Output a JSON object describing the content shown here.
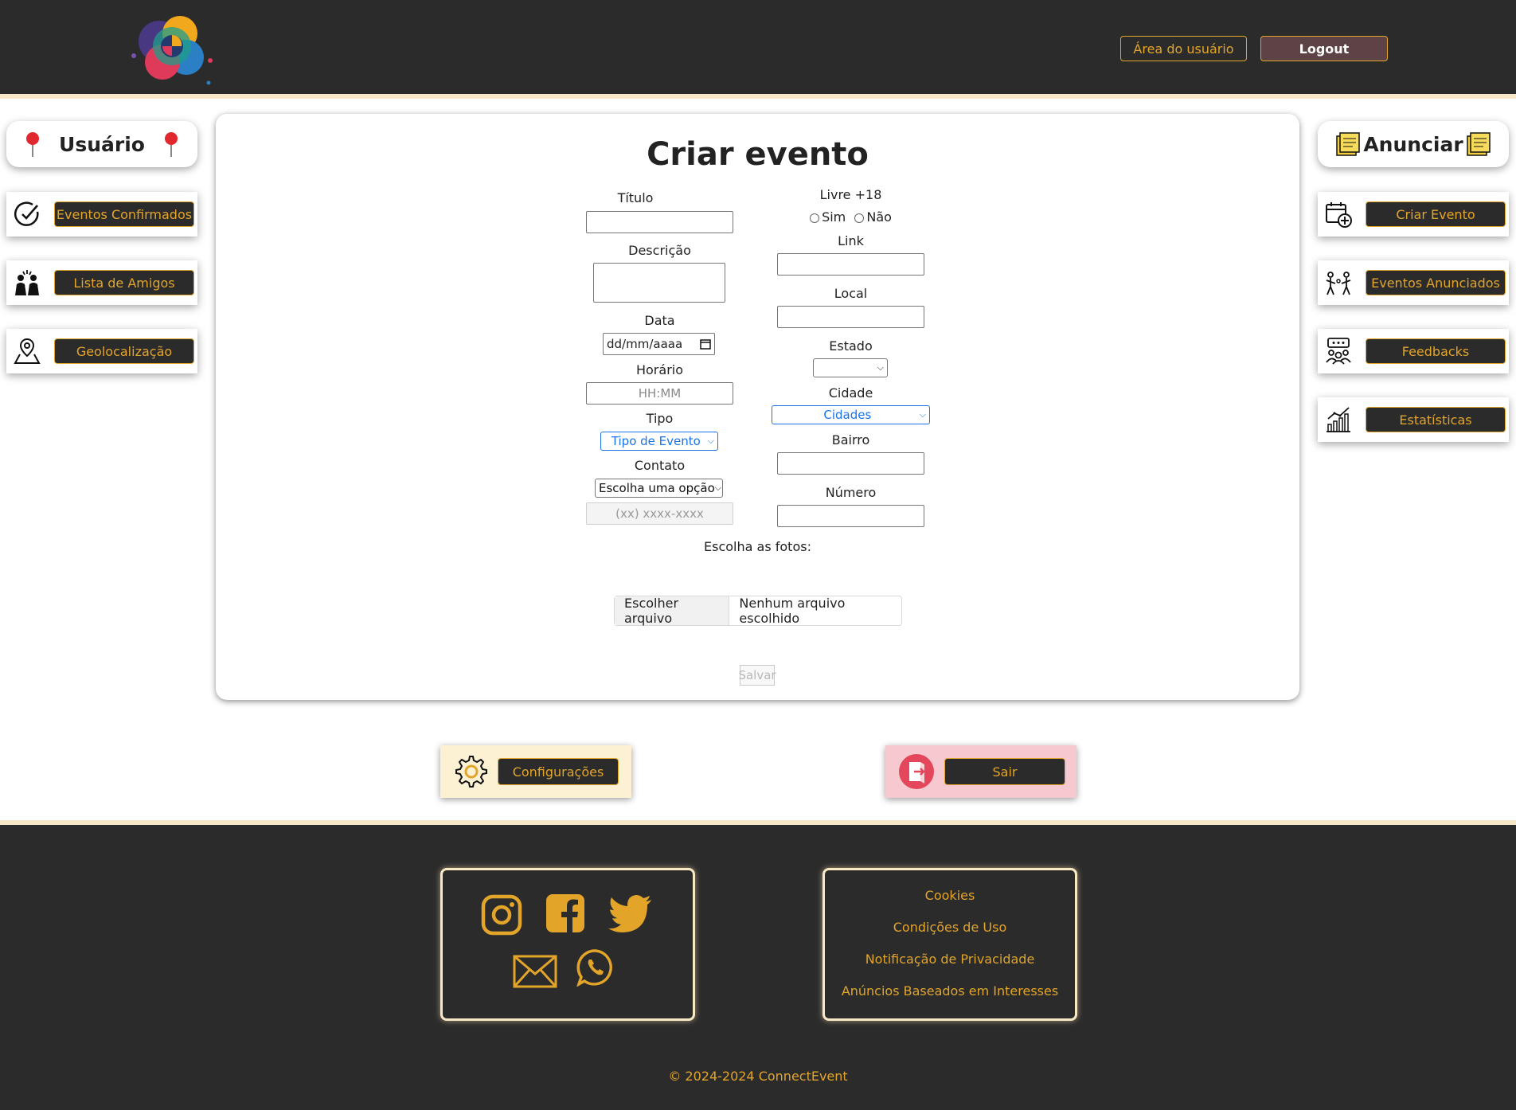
{
  "header": {
    "user_area_label": "Área do usuário",
    "logout_label": "Logout"
  },
  "left_panel": {
    "heading": "Usuário",
    "items": [
      {
        "label": "Eventos Confirmados",
        "icon": "check-circle-icon"
      },
      {
        "label": "Lista de Amigos",
        "icon": "friends-icon"
      },
      {
        "label": "Geolocalização",
        "icon": "map-pin-icon"
      }
    ]
  },
  "right_panel": {
    "heading": "Anunciar",
    "items": [
      {
        "label": "Criar Evento",
        "icon": "calendar-add-icon"
      },
      {
        "label": "Eventos Anunciados",
        "icon": "people-icon"
      },
      {
        "label": "Feedbacks",
        "icon": "feedback-icon"
      },
      {
        "label": "Estatísticas",
        "icon": "chart-icon"
      }
    ]
  },
  "form": {
    "title": "Criar evento",
    "titulo_label": "Título",
    "descricao_label": "Descrição",
    "data_label": "Data",
    "data_value": "dd/mm/aaaa",
    "horario_label": "Horário",
    "horario_placeholder": "HH:MM",
    "tipo_label": "Tipo",
    "tipo_value": "Tipo de Evento",
    "contato_label": "Contato",
    "contato_value": "Escolha uma opção",
    "contato_placeholder": "(xx) xxxx-xxxx",
    "livre_label": "Livre +18",
    "sim_label": "Sim",
    "nao_label": "Não",
    "link_label": "Link",
    "local_label": "Local",
    "estado_label": "Estado",
    "cidade_label": "Cidade",
    "cidade_value": "Cidades",
    "bairro_label": "Bairro",
    "numero_label": "Número",
    "fotos_label": "Escolha as fotos:",
    "file_button": "Escolher arquivo",
    "file_status": "Nenhum arquivo escolhido",
    "save_label": "Salvar"
  },
  "actions": {
    "config_label": "Configurações",
    "sair_label": "Sair"
  },
  "footer": {
    "links": [
      "Cookies",
      "Condições de Uso",
      "Notificação de Privacidade",
      "Anúncios Baseados em Interesses"
    ],
    "copyright": "© 2024-2024 ConnectEvent",
    "social_icons": [
      "instagram-icon",
      "facebook-icon",
      "twitter-icon",
      "email-icon",
      "whatsapp-icon"
    ]
  },
  "colors": {
    "accent": "#e2a52a",
    "dark": "#2b2b2b",
    "logout_bg": "#5e4346",
    "config_bg": "#fdf1d4",
    "sair_bg": "#f5c9cf"
  }
}
